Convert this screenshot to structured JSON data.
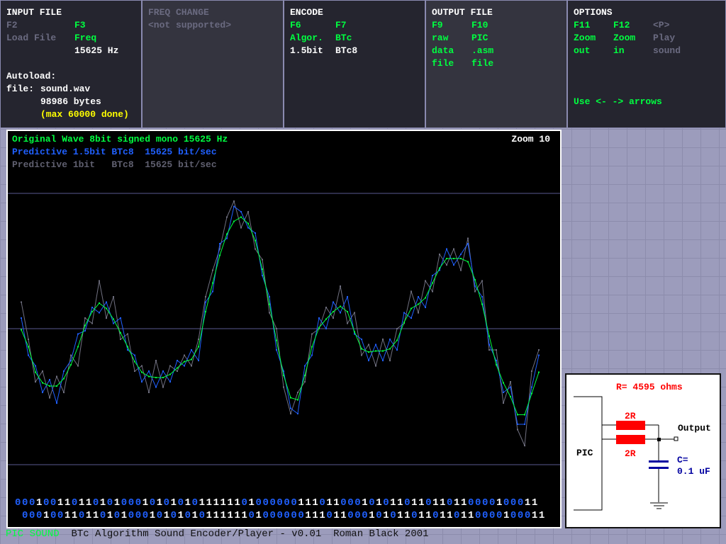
{
  "input_file": {
    "title": "INPUT FILE",
    "f2_key": "F2",
    "f2_label": "Load File",
    "f3_key": "F3",
    "f3_label": "Freq",
    "freq": "15625 Hz",
    "autoload": "Autoload:",
    "file_label": "file:",
    "file_name": "sound.wav",
    "bytes": "98986 bytes",
    "max_note": "(max 60000 done)"
  },
  "freq_change": {
    "title": "FREQ CHANGE",
    "note": "<not supported>"
  },
  "encode": {
    "title": "ENCODE",
    "f6_key": "F6",
    "f6_label": "Algor.",
    "f6_value": "1.5bit",
    "f7_key": "F7",
    "f7_label": "BTc",
    "f7_value": "BTc8"
  },
  "output_file": {
    "title": "OUTPUT FILE",
    "f9_key": "F9",
    "f9_l1": "raw",
    "f9_l2": "data",
    "f9_l3": "file",
    "f10_key": "F10",
    "f10_l1": "PIC",
    "f10_l2": ".asm",
    "f10_l3": "file"
  },
  "options": {
    "title": "OPTIONS",
    "f11_key": "F11",
    "f11_l1": "Zoom",
    "f11_l2": "out",
    "f12_key": "F12",
    "f12_l1": "Zoom",
    "f12_l2": "in",
    "p_key": "<P>",
    "p_l1": "Play",
    "p_l2": "sound",
    "hint": "Use <- -> arrows"
  },
  "plot": {
    "legend_original": "Original Wave 8bit signed mono 15625 Hz",
    "legend_pred15": "Predictive 1.5bit BTc8  15625 bit/sec",
    "legend_pred1": "Predictive 1bit   BTc8  15625 bit/sec",
    "zoom": "Zoom 10",
    "bits_row1": "00010011011010100010101010111111010000001110110001010110110110110000100011",
    "bits_row2": "00010011011010100010101010111111010000001110110001010110110110110000100011"
  },
  "chart_data": {
    "type": "line",
    "ylim": [
      -128,
      128
    ],
    "grid": false,
    "series": [
      {
        "name": "Original Wave 8bit signed mono 15625 Hz",
        "color": "#00ff40",
        "values": [
          -1,
          -17,
          -41,
          -51,
          -54,
          -54,
          -47,
          -34,
          -17,
          3,
          16,
          24,
          19,
          9,
          -4,
          -17,
          -31,
          -41,
          -45,
          -46,
          -46,
          -43,
          -37,
          -31,
          -29,
          -17,
          16,
          43,
          69,
          89,
          101,
          105,
          99,
          83,
          56,
          23,
          -11,
          -44,
          -65,
          -67,
          -44,
          -17,
          1,
          9,
          16,
          21,
          16,
          -3,
          -19,
          -22,
          -21,
          -21,
          -19,
          -11,
          6,
          19,
          23,
          29,
          43,
          57,
          66,
          66,
          66,
          63,
          46,
          23,
          -7,
          -34,
          -51,
          -64,
          -81,
          -81,
          -61,
          -41
        ]
      },
      {
        "name": "Predictive 1.5bit BTc8",
        "color": "#2060ff",
        "values": [
          10,
          -25,
          -35,
          -60,
          -48,
          -70,
          -40,
          -30,
          -5,
          -2,
          20,
          15,
          25,
          5,
          10,
          -20,
          -25,
          -50,
          -40,
          -55,
          -40,
          -50,
          -30,
          -35,
          -20,
          -30,
          25,
          35,
          80,
          85,
          115,
          110,
          95,
          90,
          50,
          30,
          -20,
          -40,
          -75,
          -80,
          -35,
          -25,
          10,
          0,
          25,
          15,
          30,
          -5,
          -10,
          -30,
          -15,
          -30,
          -10,
          -20,
          15,
          10,
          30,
          20,
          50,
          55,
          75,
          60,
          70,
          80,
          40,
          30,
          -15,
          -30,
          -60,
          -55,
          -90,
          -90,
          -55,
          -25
        ]
      },
      {
        "name": "Predictive 1bit BTc8",
        "color": "#707080",
        "values": [
          25,
          -10,
          -50,
          -40,
          -65,
          -45,
          -60,
          -25,
          -35,
          10,
          5,
          45,
          10,
          30,
          -10,
          -5,
          -40,
          -35,
          -60,
          -30,
          -55,
          -35,
          -40,
          -25,
          -35,
          -10,
          30,
          55,
          75,
          105,
          120,
          95,
          110,
          75,
          65,
          15,
          0,
          -55,
          -80,
          -60,
          -50,
          -5,
          0,
          20,
          10,
          40,
          5,
          15,
          -25,
          -15,
          -35,
          -10,
          -30,
          0,
          5,
          35,
          15,
          45,
          35,
          70,
          60,
          75,
          55,
          85,
          35,
          45,
          -20,
          -20,
          -70,
          -50,
          -95,
          -110,
          -40,
          -20
        ]
      }
    ]
  },
  "circuit": {
    "r_value": "R= 4595 ohms",
    "r1": "2R",
    "r2": "2R",
    "pic": "PIC",
    "output": "Output",
    "c_label": "C=",
    "c_value": "0.1 uF"
  },
  "status": {
    "app": "PIC SOUND",
    "title": "BTc Algorithm Sound Encoder/Player - v0.01  Roman Black 2001"
  }
}
